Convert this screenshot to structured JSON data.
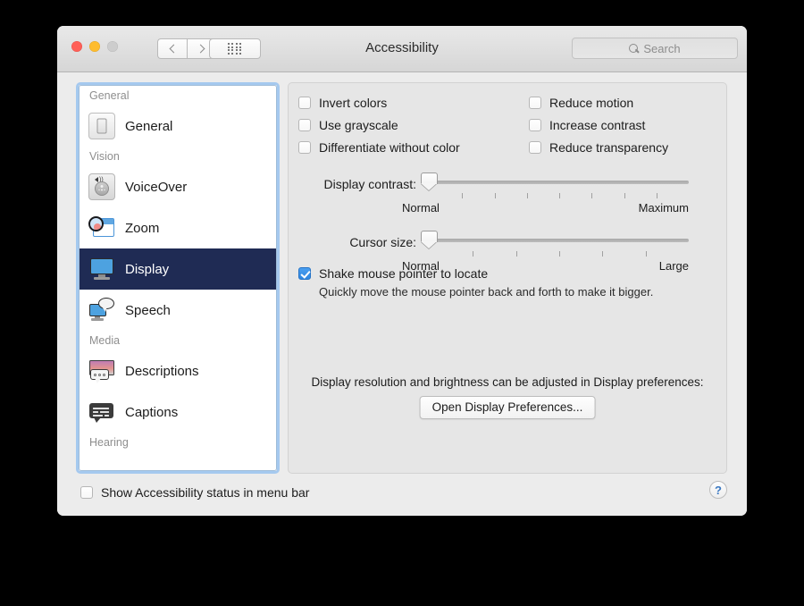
{
  "window": {
    "title": "Accessibility",
    "traffic_lights": [
      "close",
      "minimize",
      "zoom"
    ],
    "nav_back": "‹",
    "nav_forward": "›",
    "grid_button": "show-all",
    "search": {
      "placeholder": "Search",
      "value": ""
    }
  },
  "sidebar": {
    "groups": [
      {
        "title": "General",
        "items": [
          {
            "label": "General",
            "icon": "general-device-icon",
            "selected": false
          }
        ]
      },
      {
        "title": "Vision",
        "items": [
          {
            "label": "VoiceOver",
            "icon": "voiceover-icon",
            "selected": false
          },
          {
            "label": "Zoom",
            "icon": "zoom-magnifier-icon",
            "selected": false
          },
          {
            "label": "Display",
            "icon": "display-monitor-icon",
            "selected": true
          },
          {
            "label": "Speech",
            "icon": "speech-bubble-icon",
            "selected": false
          }
        ]
      },
      {
        "title": "Media",
        "items": [
          {
            "label": "Descriptions",
            "icon": "descriptions-icon",
            "selected": false
          },
          {
            "label": "Captions",
            "icon": "captions-icon",
            "selected": false
          }
        ]
      },
      {
        "title": "Hearing",
        "items": []
      }
    ]
  },
  "panel": {
    "checkboxes_left": [
      {
        "label": "Invert colors",
        "checked": false
      },
      {
        "label": "Use grayscale",
        "checked": false
      },
      {
        "label": "Differentiate without color",
        "checked": false
      }
    ],
    "checkboxes_right": [
      {
        "label": "Reduce motion",
        "checked": false
      },
      {
        "label": "Increase contrast",
        "checked": false
      },
      {
        "label": "Reduce transparency",
        "checked": false
      }
    ],
    "sliders": [
      {
        "label": "Display contrast:",
        "min_label": "Normal",
        "max_label": "Maximum",
        "value": 0,
        "ticks": 7
      },
      {
        "label": "Cursor size:",
        "min_label": "Normal",
        "max_label": "Large",
        "value": 0,
        "ticks": 5
      }
    ],
    "shake": {
      "label": "Shake mouse pointer to locate",
      "checked": true,
      "description": "Quickly move the mouse pointer back and forth to make it bigger."
    },
    "note": "Display resolution and brightness can be adjusted in Display preferences:",
    "open_prefs_button": "Open Display Preferences..."
  },
  "footer": {
    "status_checkbox": {
      "label": "Show Accessibility status in menu bar",
      "checked": false
    },
    "help_button": "?"
  },
  "colors": {
    "selection": "#1f2b54",
    "accent_checkbox": "#2f86e0",
    "focus_ring": "#a5c9ef",
    "window_chrome": "#ececec"
  }
}
